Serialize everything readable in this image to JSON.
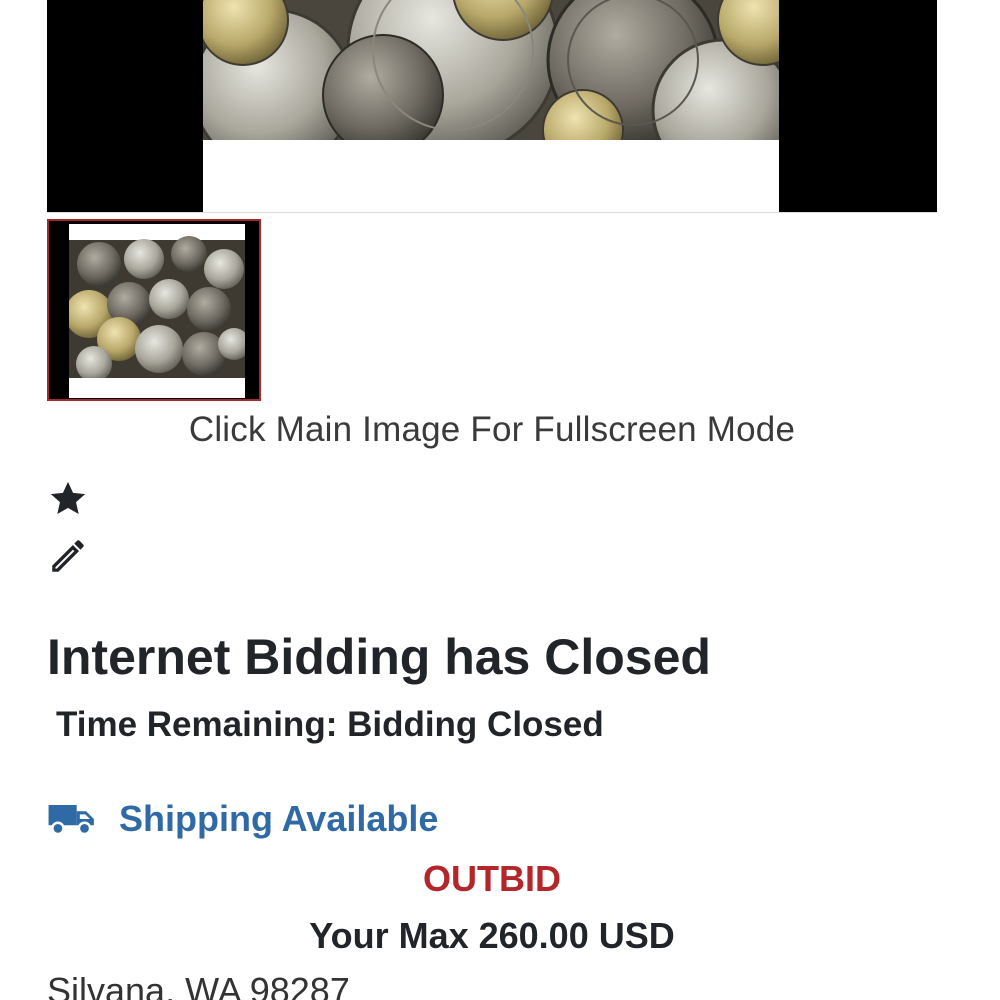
{
  "gallery": {
    "main_image_name": "silver-dollar-coins-photo",
    "thumbnail_name": "silver-dollar-coins-thumbnail",
    "caption": "Click Main Image For Fullscreen Mode"
  },
  "actions": {
    "favorite_icon": "star-icon",
    "note_icon": "pencil-icon"
  },
  "status": {
    "title": "Internet Bidding has Closed",
    "time_remaining": "Time Remaining: Bidding Closed"
  },
  "shipping": {
    "icon": "truck-icon",
    "label": "Shipping Available"
  },
  "bid": {
    "status": "OUTBID",
    "max": "Your Max 260.00 USD"
  },
  "location": "Silvana, WA 98287",
  "colors": {
    "accent_blue": "#2f6aa6",
    "outbid_red": "#b3262a",
    "thumb_border": "#a32a2a",
    "text_dark": "#212529"
  }
}
